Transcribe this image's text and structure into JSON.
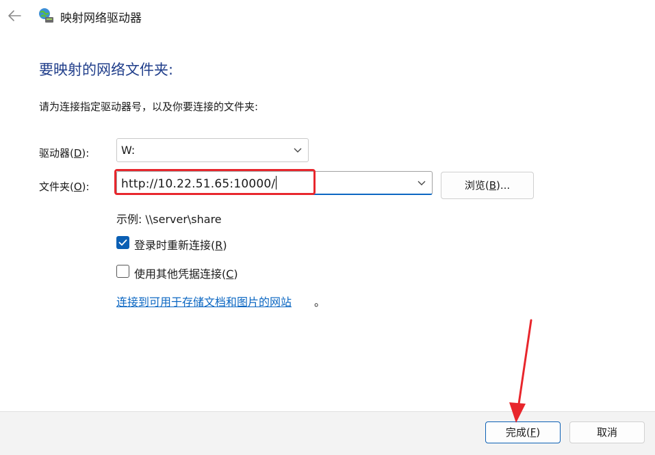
{
  "window": {
    "title": "映射网络驱动器",
    "back_icon": "back-arrow-icon",
    "app_icon": "network-drive-icon"
  },
  "main": {
    "heading": "要映射的网络文件夹:",
    "instruction": "请为连接指定驱动器号，以及你要连接的文件夹:",
    "drive": {
      "label_pre": "驱动器(",
      "label_key": "D",
      "label_post": "):",
      "value": "W:"
    },
    "folder": {
      "label_pre": "文件夹(",
      "label_key": "O",
      "label_post": "):",
      "value": "http://10.22.51.65:10000/"
    },
    "browse_pre": "浏览(",
    "browse_key": "B",
    "browse_post": ")...",
    "example": "示例: \\\\server\\share",
    "reconnect": {
      "label_pre": "登录时重新连接(",
      "label_key": "R",
      "label_post": ")",
      "checked": true
    },
    "other_credentials": {
      "label_pre": "使用其他凭据连接(",
      "label_key": "C",
      "label_post": ")",
      "checked": false
    },
    "website_link": "连接到可用于存储文档和图片的网站",
    "website_link_suffix": "。"
  },
  "footer": {
    "finish_pre": "完成(",
    "finish_key": "F",
    "finish_post": ")",
    "cancel": "取消"
  },
  "colors": {
    "accent": "#0a5fb4",
    "heading": "#1f3d8a",
    "annotation": "#e8262c"
  }
}
